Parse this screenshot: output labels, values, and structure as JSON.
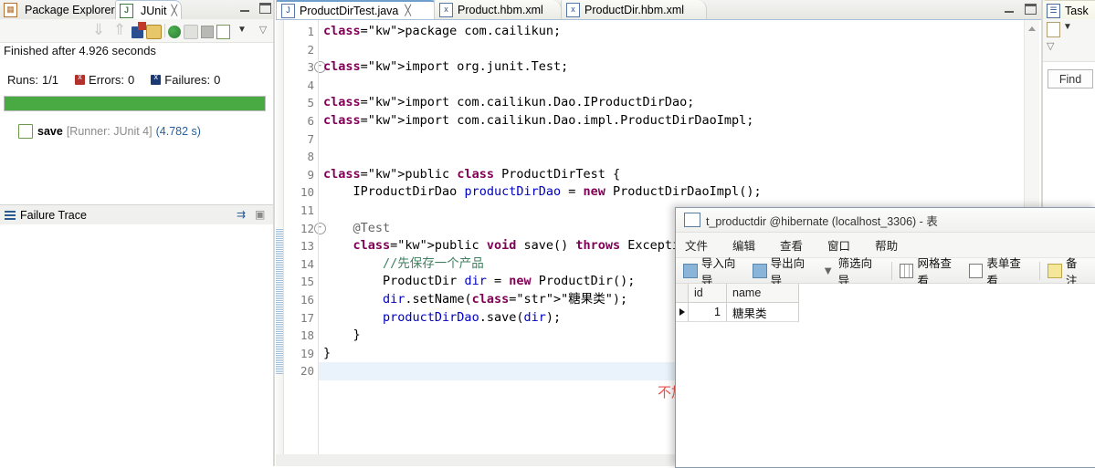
{
  "junit": {
    "tabs": [
      {
        "label": "Package Explorer",
        "icon": "package-explorer-icon",
        "active": false
      },
      {
        "label": "JUnit",
        "icon": "junit-icon",
        "active": true,
        "close": "╳"
      }
    ],
    "status": "Finished after 4.926 seconds",
    "counters": [
      {
        "label": "Runs:",
        "value": "1/1",
        "icon": ""
      },
      {
        "label": "Errors:",
        "value": "0",
        "icon": "error-square-icon"
      },
      {
        "label": "Failures:",
        "value": "0",
        "icon": "failure-square-icon"
      }
    ],
    "progress": {
      "percent": 100,
      "color": "#49a942"
    },
    "result": {
      "name": "save",
      "runner": "[Runner: JUnit 4]",
      "time": "(4.782 s)"
    },
    "failure_trace_label": "Failure Trace",
    "toolbar_icons": [
      "next-failure-icon",
      "previous-failure-icon",
      "show-failures-only-icon",
      "lock-scroll-icon",
      "rerun-test-icon",
      "rerun-failed-icon",
      "stop-icon",
      "test-run-history-icon",
      "view-menu-icon",
      "minimize-icon"
    ]
  },
  "editor": {
    "tabs": [
      {
        "label": "ProductDirTest.java",
        "icon": "java-file-icon",
        "badge": "J",
        "active": true,
        "close": "╳"
      },
      {
        "label": "Product.hbm.xml",
        "icon": "xml-file-icon",
        "badge": "x",
        "active": false
      },
      {
        "label": "ProductDir.hbm.xml",
        "icon": "xml-file-icon",
        "badge": "x",
        "active": false
      }
    ],
    "lines": [
      {
        "no": "1",
        "fold": "",
        "current": false
      },
      {
        "no": "2",
        "fold": "",
        "current": false
      },
      {
        "no": "3",
        "fold": "-",
        "current": false
      },
      {
        "no": "4",
        "fold": "",
        "current": false
      },
      {
        "no": "5",
        "fold": "",
        "current": false
      },
      {
        "no": "6",
        "fold": "",
        "current": false
      },
      {
        "no": "7",
        "fold": "",
        "current": false
      },
      {
        "no": "8",
        "fold": "",
        "current": false
      },
      {
        "no": "9",
        "fold": "",
        "current": false
      },
      {
        "no": "10",
        "fold": "",
        "current": false
      },
      {
        "no": "11",
        "fold": "",
        "current": false
      },
      {
        "no": "12",
        "fold": "-",
        "current": false
      },
      {
        "no": "13",
        "fold": "",
        "current": false
      },
      {
        "no": "14",
        "fold": "",
        "current": false
      },
      {
        "no": "15",
        "fold": "",
        "current": false
      },
      {
        "no": "16",
        "fold": "",
        "current": false
      },
      {
        "no": "17",
        "fold": "",
        "current": false
      },
      {
        "no": "18",
        "fold": "",
        "current": false
      },
      {
        "no": "19",
        "fold": "",
        "current": false
      },
      {
        "no": "20",
        "fold": "",
        "current": true
      }
    ],
    "code_text": [
      "package com.cailikun;",
      "",
      "import org.junit.Test;",
      "",
      "import com.cailikun.Dao.IProductDirDao;",
      "import com.cailikun.Dao.impl.ProductDirDaoImpl;",
      "",
      "",
      "public class ProductDirTest {",
      "    IProductDirDao productDirDao = new ProductDirDaoImpl();",
      "",
      "    @Test",
      "    public void save() throws Exception {",
      "        //先保存一个产品",
      "        ProductDir dir = new ProductDir();",
      "        dir.setName(\"糖果类\");",
      "        productDirDao.save(dir);",
      "    }",
      "}",
      ""
    ],
    "annotation": "不加上图那句红框圈出的代码，就不会报错........",
    "annotation_color": "#f0504a"
  },
  "task": {
    "tab_label": "Task",
    "tab_icon": "task-list-icon",
    "toolbar_icons": [
      "new-task-icon",
      "chevron-down-icon",
      "view-menu-icon"
    ],
    "find_label": "Find"
  },
  "dbwindow": {
    "title": "t_productdir @hibernate (localhost_3306) - 表",
    "title_icon": "table-icon",
    "menus": [
      "文件",
      "编辑",
      "查看",
      "窗口",
      "帮助"
    ],
    "toolbar": [
      {
        "label": "导入向导",
        "icon": "import-wizard-icon"
      },
      {
        "label": "导出向导",
        "icon": "export-wizard-icon"
      },
      {
        "label": "筛选向导",
        "icon": "filter-wizard-icon"
      },
      {
        "label": "网格查看",
        "icon": "grid-view-icon"
      },
      {
        "label": "表单查看",
        "icon": "form-view-icon"
      },
      {
        "label": "备注",
        "icon": "memo-icon"
      }
    ],
    "columns": [
      "id",
      "name"
    ],
    "rows": [
      [
        "1",
        "糖果类"
      ]
    ]
  }
}
